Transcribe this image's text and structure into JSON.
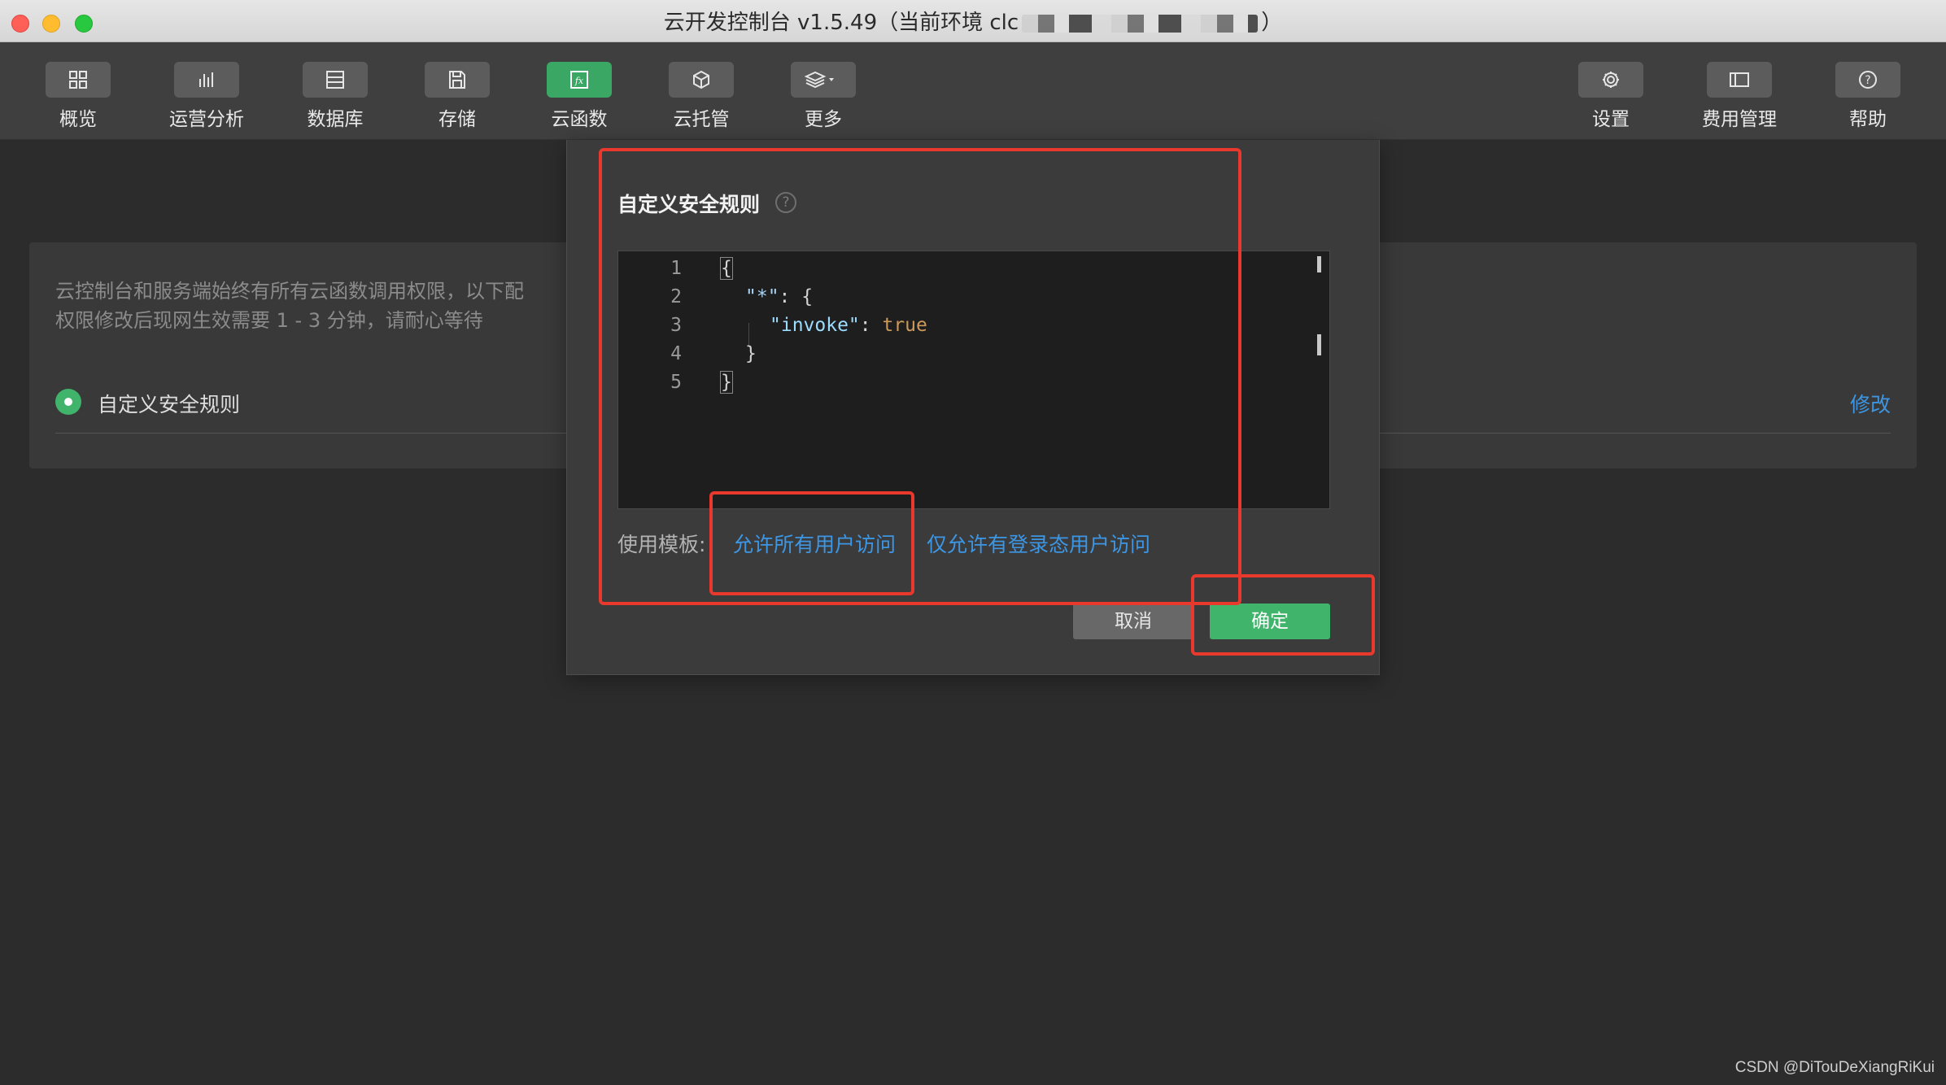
{
  "window": {
    "title_prefix": "云开发控制台 v1.5.49（当前环境 clc",
    "title_suffix": "）"
  },
  "toolbar": {
    "left": [
      {
        "label": "概览",
        "icon": "grid-icon"
      },
      {
        "label": "运营分析",
        "icon": "bar-chart-icon"
      },
      {
        "label": "数据库",
        "icon": "database-icon"
      },
      {
        "label": "存储",
        "icon": "save-icon"
      },
      {
        "label": "云函数",
        "icon": "function-icon",
        "active": true
      },
      {
        "label": "云托管",
        "icon": "cube-icon"
      },
      {
        "label": "更多",
        "icon": "layers-icon"
      }
    ],
    "right": [
      {
        "label": "设置",
        "icon": "gear-icon"
      },
      {
        "label": "费用管理",
        "icon": "billing-icon"
      },
      {
        "label": "帮助",
        "icon": "help-icon"
      }
    ]
  },
  "main": {
    "desc_line1": "云控制台和服务端始终有所有云函数调用权限，以下配",
    "desc_line2": "权限修改后现网生效需要 1 - 3 分钟，请耐心等待",
    "rule_label": "自定义安全规则",
    "edit_link": "修改"
  },
  "modal": {
    "title": "自定义安全规则",
    "help_symbol": "?",
    "editor": {
      "line_numbers": [
        "1",
        "2",
        "3",
        "4",
        "5"
      ],
      "lines": {
        "l1": "{",
        "l2_key": "\"*\"",
        "l2_rest": ": {",
        "l3_key": "\"invoke\"",
        "l3_colon": ": ",
        "l3_val": "true",
        "l4": "}",
        "l5": "}"
      }
    },
    "template_label": "使用模板:",
    "template_all": "允许所有用户访问",
    "template_login": "仅允许有登录态用户访问",
    "cancel": "取消",
    "confirm": "确定"
  },
  "colors": {
    "accent_green": "#3fb46a",
    "link_blue": "#3c96e4",
    "annotation_red": "#e8392c"
  },
  "watermark": "CSDN @DiTouDeXiangRiKui"
}
